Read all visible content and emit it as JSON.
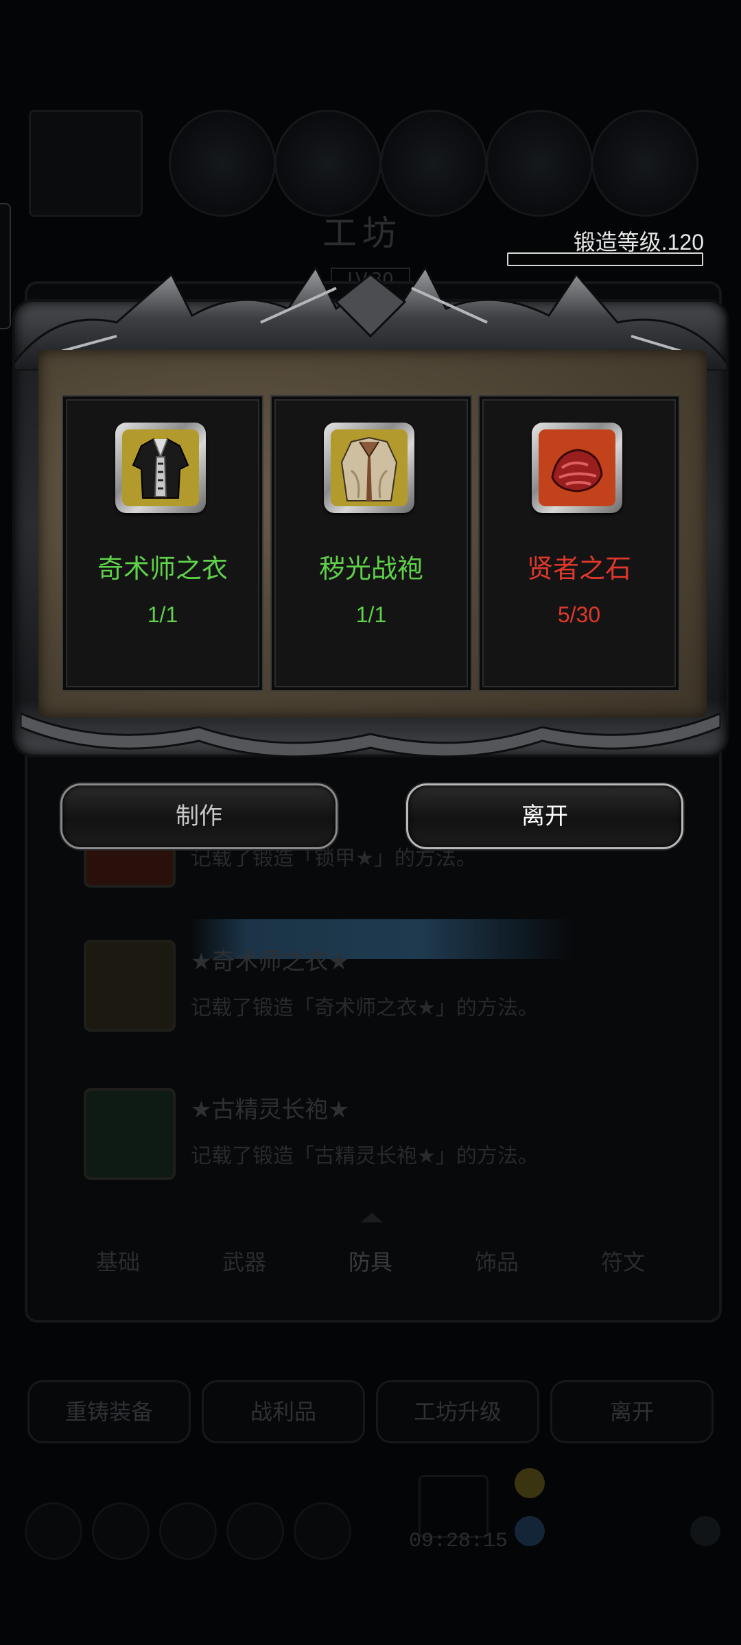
{
  "background_screen": {
    "title": "工坊",
    "level": "LV.30",
    "forge_level_label": "锻造等级.120",
    "forge_progress_fraction": 0.0,
    "recipes": [
      {
        "name": "",
        "desc": "记载了锻造「锁甲★」的方法。",
        "icon_color": "#2a100b"
      },
      {
        "name": "★奇术师之衣★",
        "desc": "记载了锻造「奇术师之衣★」的方法。",
        "icon_color": "#1c1a10"
      },
      {
        "name": "★古精灵长袍★",
        "desc": "记载了锻造「古精灵长袍★」的方法。",
        "icon_color": "#0e1a14"
      }
    ],
    "tabs": [
      {
        "label": "基础",
        "active": false
      },
      {
        "label": "武器",
        "active": false
      },
      {
        "label": "防具",
        "active": true
      },
      {
        "label": "饰品",
        "active": false
      },
      {
        "label": "符文",
        "active": false
      }
    ],
    "bottom_buttons": [
      "重铸装备",
      "战利品",
      "工坊升级",
      "离开"
    ],
    "timer": "09:28:15"
  },
  "craft_dialog": {
    "materials": [
      {
        "name": "奇术师之衣",
        "count": "1/1",
        "name_color": "#5fd14a",
        "count_color": "#5fd14a",
        "frame_bg": "#b29a2c",
        "icon": "magician-coat-icon"
      },
      {
        "name": "秽光战袍",
        "count": "1/1",
        "name_color": "#5fd14a",
        "count_color": "#5fd14a",
        "frame_bg": "#b29a2c",
        "icon": "battle-robe-icon"
      },
      {
        "name": "贤者之石",
        "count": "5/30",
        "name_color": "#e0382c",
        "count_color": "#e0382c",
        "frame_bg": "#c2421c",
        "icon": "sage-stone-icon"
      }
    ],
    "craft_button": "制作",
    "leave_button": "离开"
  }
}
